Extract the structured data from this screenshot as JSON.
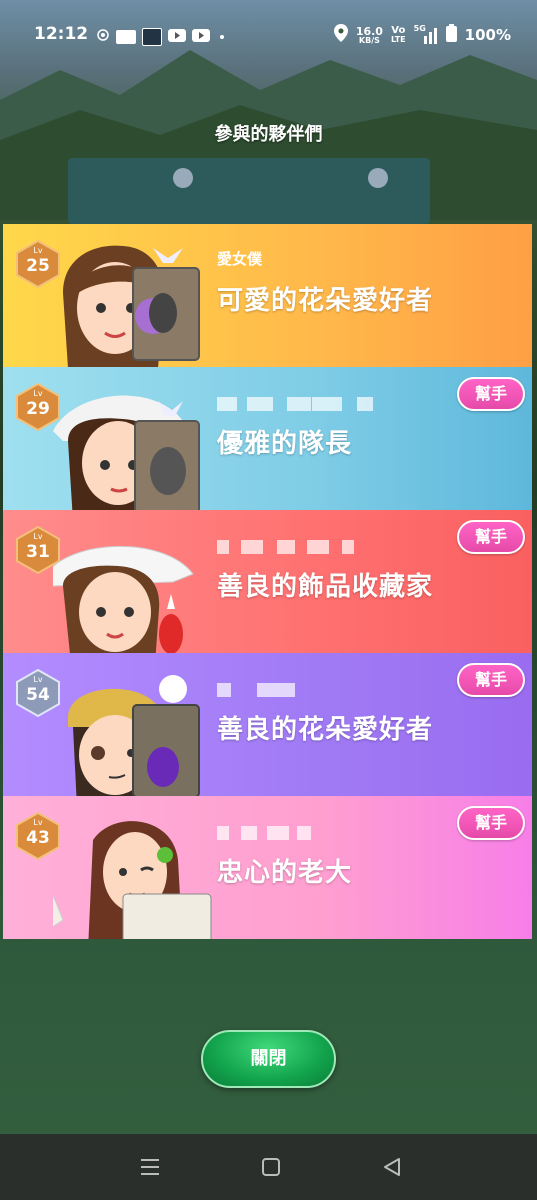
{
  "status_bar": {
    "time": "12:12",
    "network_speed_value": "16.0",
    "network_speed_unit": "KB/S",
    "volte_top": "Vo",
    "volte_bottom": "LTE",
    "signal_label": "5G",
    "battery": "100%"
  },
  "page_title": "參與的夥伴們",
  "level_prefix": "Lv",
  "participants": [
    {
      "level": "25",
      "subtitle": "愛女僕",
      "title": "可愛的花朵愛好者",
      "color_theme": "yellow",
      "badge": "bronze",
      "show_help": false
    },
    {
      "level": "29",
      "subtitle": "",
      "title": "優雅的隊長",
      "color_theme": "cyan",
      "badge": "bronze",
      "show_help": true
    },
    {
      "level": "31",
      "subtitle": "",
      "title": "善良的飾品收藏家",
      "color_theme": "red",
      "badge": "bronze",
      "show_help": true
    },
    {
      "level": "54",
      "subtitle": "",
      "title": "善良的花朵愛好者",
      "color_theme": "purple",
      "badge": "silver",
      "show_help": true
    },
    {
      "level": "43",
      "subtitle": "",
      "title": "忠心的老大",
      "color_theme": "pink",
      "badge": "bronze",
      "show_help": true
    }
  ],
  "help_button_label": "幫手",
  "close_button_label": "關閉",
  "nav_icons": [
    "menu-icon",
    "home-icon",
    "back-icon"
  ],
  "colors": {
    "help_button": "#f257b9",
    "close_button": "#17a850",
    "badge_bronze": "#d98a3a",
    "badge_silver": "#8e9bb8"
  }
}
